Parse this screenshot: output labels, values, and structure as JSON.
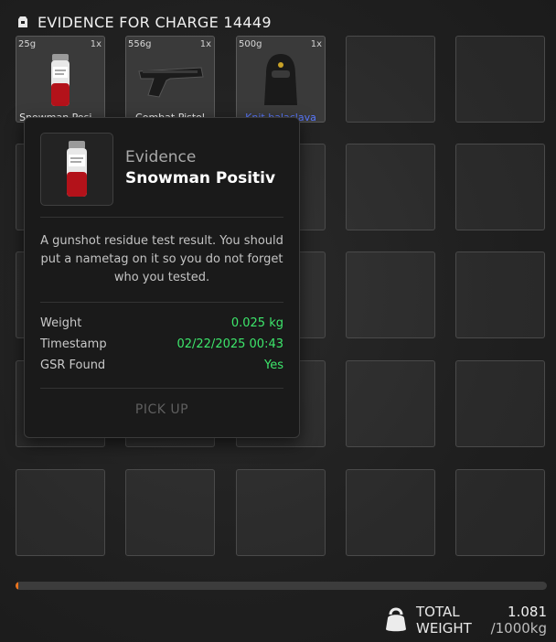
{
  "header": {
    "icon": "evidence-bag-icon",
    "title": "EVIDENCE FOR CHARGE 14449"
  },
  "items": [
    {
      "weight": "25g",
      "qty": "1x",
      "name": "Snowman Posi...",
      "icon": "gsr-test-vial-icon"
    },
    {
      "weight": "556g",
      "qty": "1x",
      "name": "Combat Pistol",
      "icon": "pistol-icon"
    },
    {
      "weight": "500g",
      "qty": "1x",
      "name": "Knit balaclava",
      "icon": "balaclava-icon",
      "name_color": "#5a79ff"
    }
  ],
  "tooltip": {
    "category": "Evidence",
    "name": "Snowman Positiv",
    "description": "A gunshot residue test result. You should put a nametag on it so you do not forget who you tested.",
    "details": [
      {
        "label": "Weight",
        "value": "0.025 kg"
      },
      {
        "label": "Timestamp",
        "value": "02/22/2025 00:43"
      },
      {
        "label": "GSR Found",
        "value": "Yes"
      }
    ],
    "action": "PICK UP",
    "value_color": "#3de66b"
  },
  "capacity": {
    "total_label_1": "TOTAL",
    "total_label_2": "WEIGHT",
    "current": "1.081",
    "max": "/1000kg",
    "fill_fraction": 0.001081,
    "bar_color": "#e8731d",
    "icon": "kettlebell-icon"
  }
}
